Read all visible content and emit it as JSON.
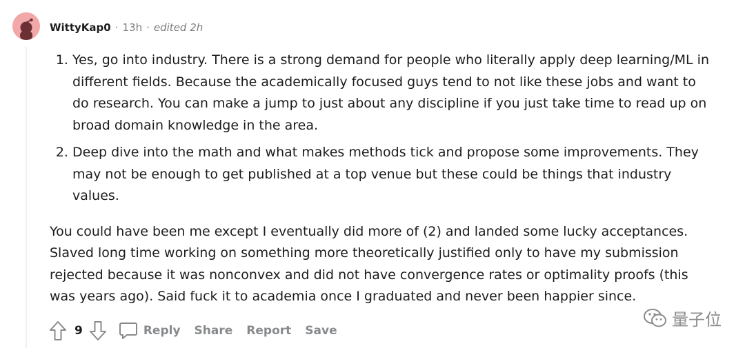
{
  "comment": {
    "author": "WittyKap0",
    "separator": "·",
    "time_ago": "13h",
    "edited": "edited 2h",
    "list_items": [
      "Yes, go into industry. There is a strong demand for people who literally apply deep learning/ML in different fields. Because the academically focused guys tend to not like these jobs and want to do research. You can make a jump to just about any discipline if you just take time to read up on broad domain knowledge in the area.",
      "Deep dive into the math and what makes methods tick and propose some improvements. They may not be enough to get published at a top venue but these could be things that industry values."
    ],
    "paragraph": "You could have been me except I eventually did more of (2) and landed some lucky acceptances. Slaved long time working on something more theoretically justified only to have my submission rejected because it was nonconvex and did not have convergence rates or optimality proofs (this was years ago). Said fuck it to academia once I graduated and never been happier since."
  },
  "actions": {
    "score": "9",
    "reply": "Reply",
    "share": "Share",
    "report": "Report",
    "save": "Save"
  },
  "watermark": {
    "text": "量子位"
  },
  "colors": {
    "avatar_bg": "#f2a7a9",
    "avatar_figure": "#6b3033",
    "muted_text": "#7c7c7c",
    "action_text": "#878a8c",
    "thread_line": "#edeff1"
  },
  "icons": [
    "reddit-avatar-icon",
    "upvote-arrow-icon",
    "downvote-arrow-icon",
    "comment-bubble-icon",
    "wechat-logo-icon"
  ]
}
